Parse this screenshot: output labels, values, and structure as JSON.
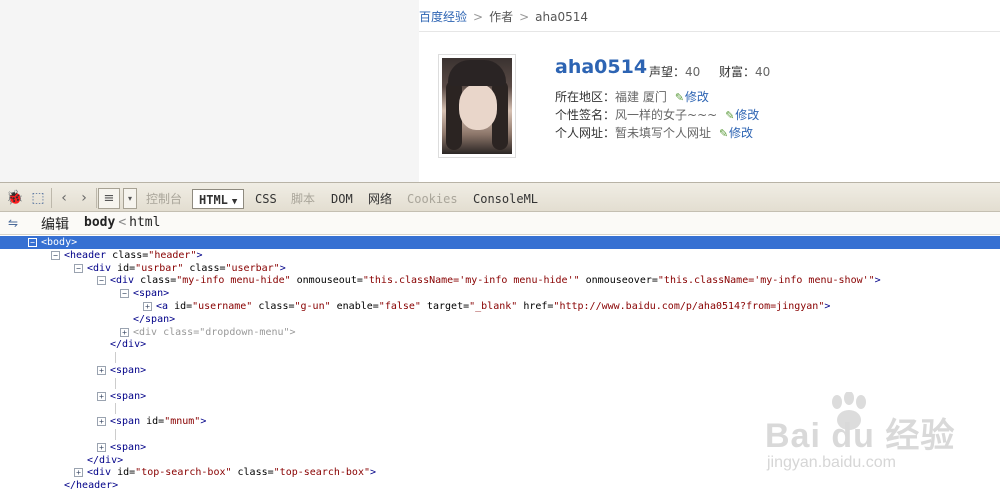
{
  "breadcrumb": {
    "root": "百度经验",
    "author": "作者",
    "current": "aha0514"
  },
  "profile": {
    "username": "aha0514",
    "prestige_label": "声望：",
    "prestige_value": "40",
    "wealth_label": "财富：",
    "wealth_value": "40",
    "location_label": "所在地区：",
    "location_value": "福建 厦门",
    "signature_label": "个性签名：",
    "signature_value": "风一样的女子~~~",
    "homepage_label": "个人网址：",
    "homepage_value": "暂未填写个人网址",
    "edit_label": "修改"
  },
  "devtools": {
    "tabs": [
      {
        "label": "控制台",
        "state": "disabled"
      },
      {
        "label": "HTML",
        "state": "active"
      },
      {
        "label": "CSS",
        "state": "normal"
      },
      {
        "label": "脚本",
        "state": "disabled"
      },
      {
        "label": "DOM",
        "state": "normal"
      },
      {
        "label": "网络",
        "state": "normal"
      },
      {
        "label": "Cookies",
        "state": "disabled"
      },
      {
        "label": "ConsoleML",
        "state": "normal"
      }
    ],
    "sub": {
      "edit_label": "编辑",
      "crumb_body": "body",
      "crumb_html": "html"
    }
  },
  "tree": [
    {
      "indent": 0,
      "toggle": "minus",
      "selected": true,
      "parts": [
        [
          "tag",
          "<body>"
        ]
      ]
    },
    {
      "indent": 1,
      "toggle": "minus",
      "parts": [
        [
          "tag",
          "<header "
        ],
        [
          "attr",
          "class="
        ],
        [
          "aval",
          "\"header\""
        ],
        [
          "tag",
          ">"
        ]
      ]
    },
    {
      "indent": 2,
      "toggle": "minus",
      "parts": [
        [
          "tag",
          "<div "
        ],
        [
          "attr",
          "id="
        ],
        [
          "aval",
          "\"usrbar\""
        ],
        [
          "attr",
          " class="
        ],
        [
          "aval",
          "\"userbar\""
        ],
        [
          "tag",
          ">"
        ]
      ]
    },
    {
      "indent": 3,
      "toggle": "minus",
      "parts": [
        [
          "tag",
          "<div "
        ],
        [
          "attr",
          "class="
        ],
        [
          "aval",
          "\"my-info menu-hide\""
        ],
        [
          "attr",
          " onmouseout="
        ],
        [
          "aval",
          "\"this.className='my-info menu-hide'\""
        ],
        [
          "attr",
          " onmouseover="
        ],
        [
          "aval",
          "\"this.className='my-info menu-show'\""
        ],
        [
          "tag",
          ">"
        ]
      ]
    },
    {
      "indent": 4,
      "toggle": "minus",
      "parts": [
        [
          "tag",
          "<span>"
        ]
      ]
    },
    {
      "indent": 5,
      "toggle": "plus",
      "parts": [
        [
          "tag",
          "<a "
        ],
        [
          "attr",
          "id="
        ],
        [
          "aval",
          "\"username\""
        ],
        [
          "attr",
          " class="
        ],
        [
          "aval",
          "\"g-un\""
        ],
        [
          "attr",
          " enable="
        ],
        [
          "aval",
          "\"false\""
        ],
        [
          "attr",
          " target="
        ],
        [
          "aval",
          "\"_blank\""
        ],
        [
          "attr",
          " href="
        ],
        [
          "aval",
          "\"http://www.baidu.com/p/aha0514?from=jingyan\""
        ],
        [
          "tag",
          ">"
        ]
      ]
    },
    {
      "indent": 4,
      "toggle": "none",
      "parts": [
        [
          "tag",
          "</span>"
        ]
      ]
    },
    {
      "indent": 4,
      "toggle": "plus",
      "parts": [
        [
          "dim",
          "<div class=\"dropdown-menu\">"
        ]
      ]
    },
    {
      "indent": 3,
      "toggle": "none",
      "parts": [
        [
          "tag",
          "</div>"
        ]
      ]
    },
    {
      "indent": 3,
      "toggle": "pipe",
      "parts": []
    },
    {
      "indent": 3,
      "toggle": "plus",
      "parts": [
        [
          "tag",
          "<span>"
        ]
      ]
    },
    {
      "indent": 3,
      "toggle": "pipe",
      "parts": []
    },
    {
      "indent": 3,
      "toggle": "plus",
      "parts": [
        [
          "tag",
          "<span>"
        ]
      ]
    },
    {
      "indent": 3,
      "toggle": "pipe",
      "parts": []
    },
    {
      "indent": 3,
      "toggle": "plus",
      "parts": [
        [
          "tag",
          "<span "
        ],
        [
          "attr",
          "id="
        ],
        [
          "aval",
          "\"mnum\""
        ],
        [
          "tag",
          ">"
        ]
      ]
    },
    {
      "indent": 3,
      "toggle": "pipe",
      "parts": []
    },
    {
      "indent": 3,
      "toggle": "plus",
      "parts": [
        [
          "tag",
          "<span>"
        ]
      ]
    },
    {
      "indent": 2,
      "toggle": "none",
      "parts": [
        [
          "tag",
          "</div>"
        ]
      ]
    },
    {
      "indent": 2,
      "toggle": "plus",
      "parts": [
        [
          "tag",
          "<div "
        ],
        [
          "attr",
          "id="
        ],
        [
          "aval",
          "\"top-search-box\""
        ],
        [
          "attr",
          " class="
        ],
        [
          "aval",
          "\"top-search-box\""
        ],
        [
          "tag",
          ">"
        ]
      ]
    },
    {
      "indent": 1,
      "toggle": "none",
      "parts": [
        [
          "tag",
          "</header>"
        ]
      ]
    }
  ],
  "watermark": {
    "brand": "Bai du 经验",
    "url": "jingyan.baidu.com"
  },
  "icons": [
    "inspect-icon",
    "select-element-icon",
    "back-icon",
    "forward-icon",
    "list-icon",
    "dropdown-arrow-icon"
  ]
}
